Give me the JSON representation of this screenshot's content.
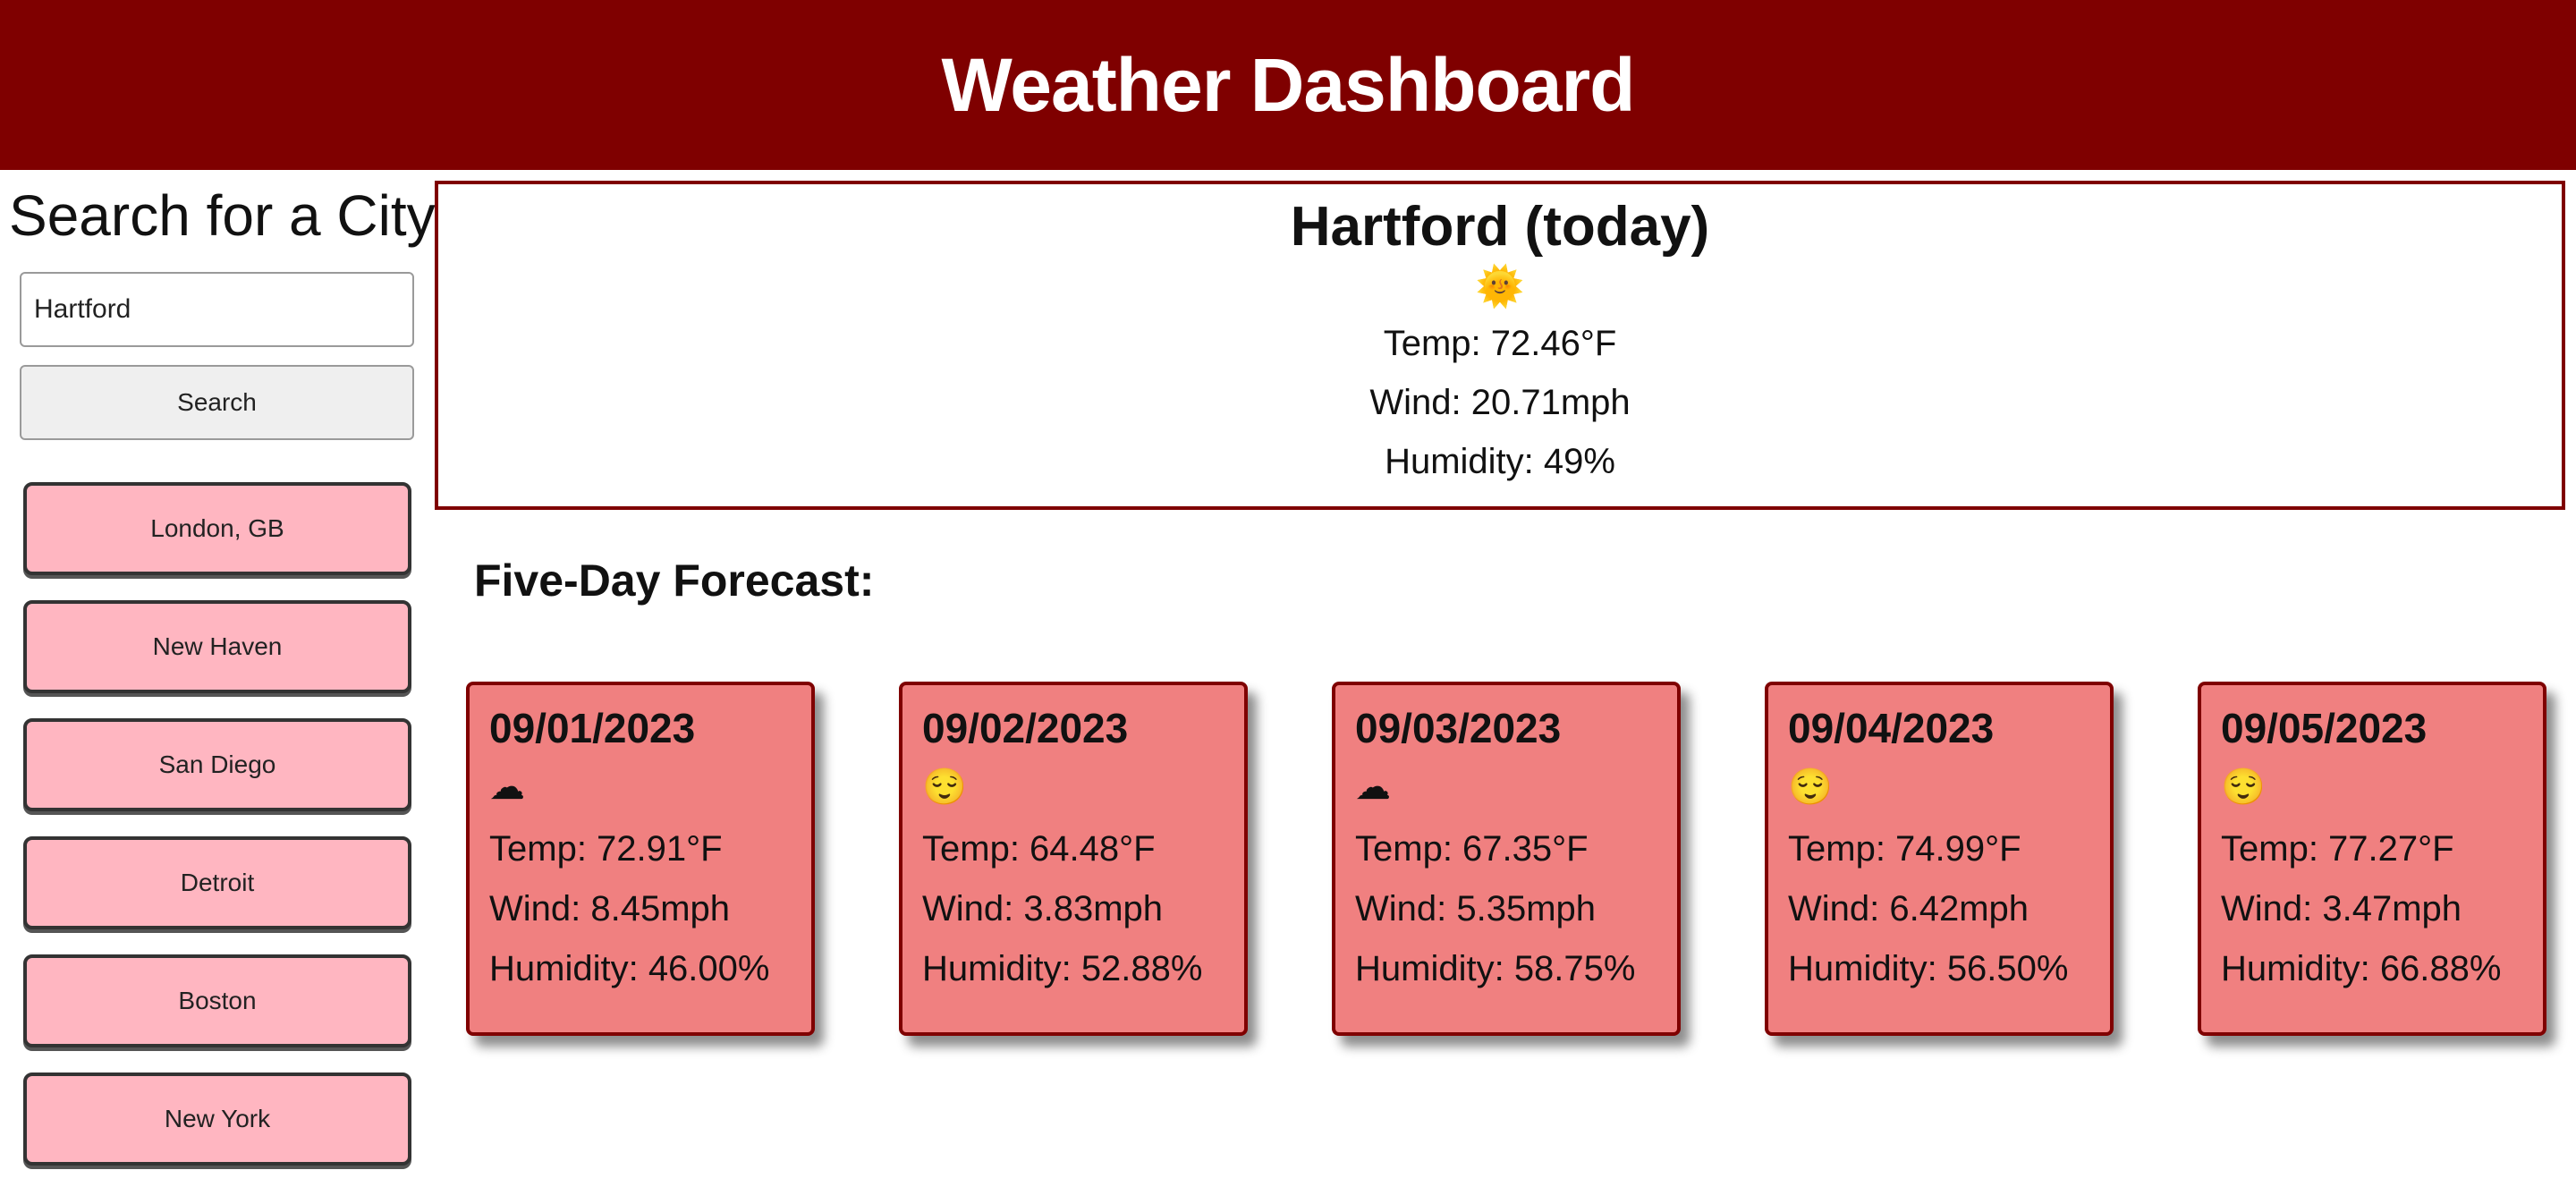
{
  "header": {
    "title": "Weather Dashboard"
  },
  "sidebar": {
    "heading": "Search for a City:",
    "search_value": "Hartford",
    "search_button": "Search",
    "history": [
      "London, GB",
      "New Haven",
      "San Diego",
      "Detroit",
      "Boston",
      "New York"
    ]
  },
  "current": {
    "title": "Hartford (today)",
    "icon": "🌞",
    "temp": "Temp: 72.46°F",
    "wind": "Wind: 20.71mph",
    "humidity": "Humidity: 49%"
  },
  "forecast": {
    "title": "Five-Day Forecast:",
    "days": [
      {
        "date": "09/01/2023",
        "icon": "☁",
        "temp": "Temp: 72.91°F",
        "wind": "Wind: 8.45mph",
        "humidity": "Humidity: 46.00%"
      },
      {
        "date": "09/02/2023",
        "icon": "😌",
        "temp": "Temp: 64.48°F",
        "wind": "Wind: 3.83mph",
        "humidity": "Humidity: 52.88%"
      },
      {
        "date": "09/03/2023",
        "icon": "☁",
        "temp": "Temp: 67.35°F",
        "wind": "Wind: 5.35mph",
        "humidity": "Humidity: 58.75%"
      },
      {
        "date": "09/04/2023",
        "icon": "😌",
        "temp": "Temp: 74.99°F",
        "wind": "Wind: 6.42mph",
        "humidity": "Humidity: 56.50%"
      },
      {
        "date": "09/05/2023",
        "icon": "😌",
        "temp": "Temp: 77.27°F",
        "wind": "Wind: 3.47mph",
        "humidity": "Humidity: 66.88%"
      }
    ]
  },
  "colors": {
    "header": "#7f0000",
    "history_button": "#ffb6c1",
    "forecast_card": "#f08080",
    "border": "#7f0000"
  }
}
